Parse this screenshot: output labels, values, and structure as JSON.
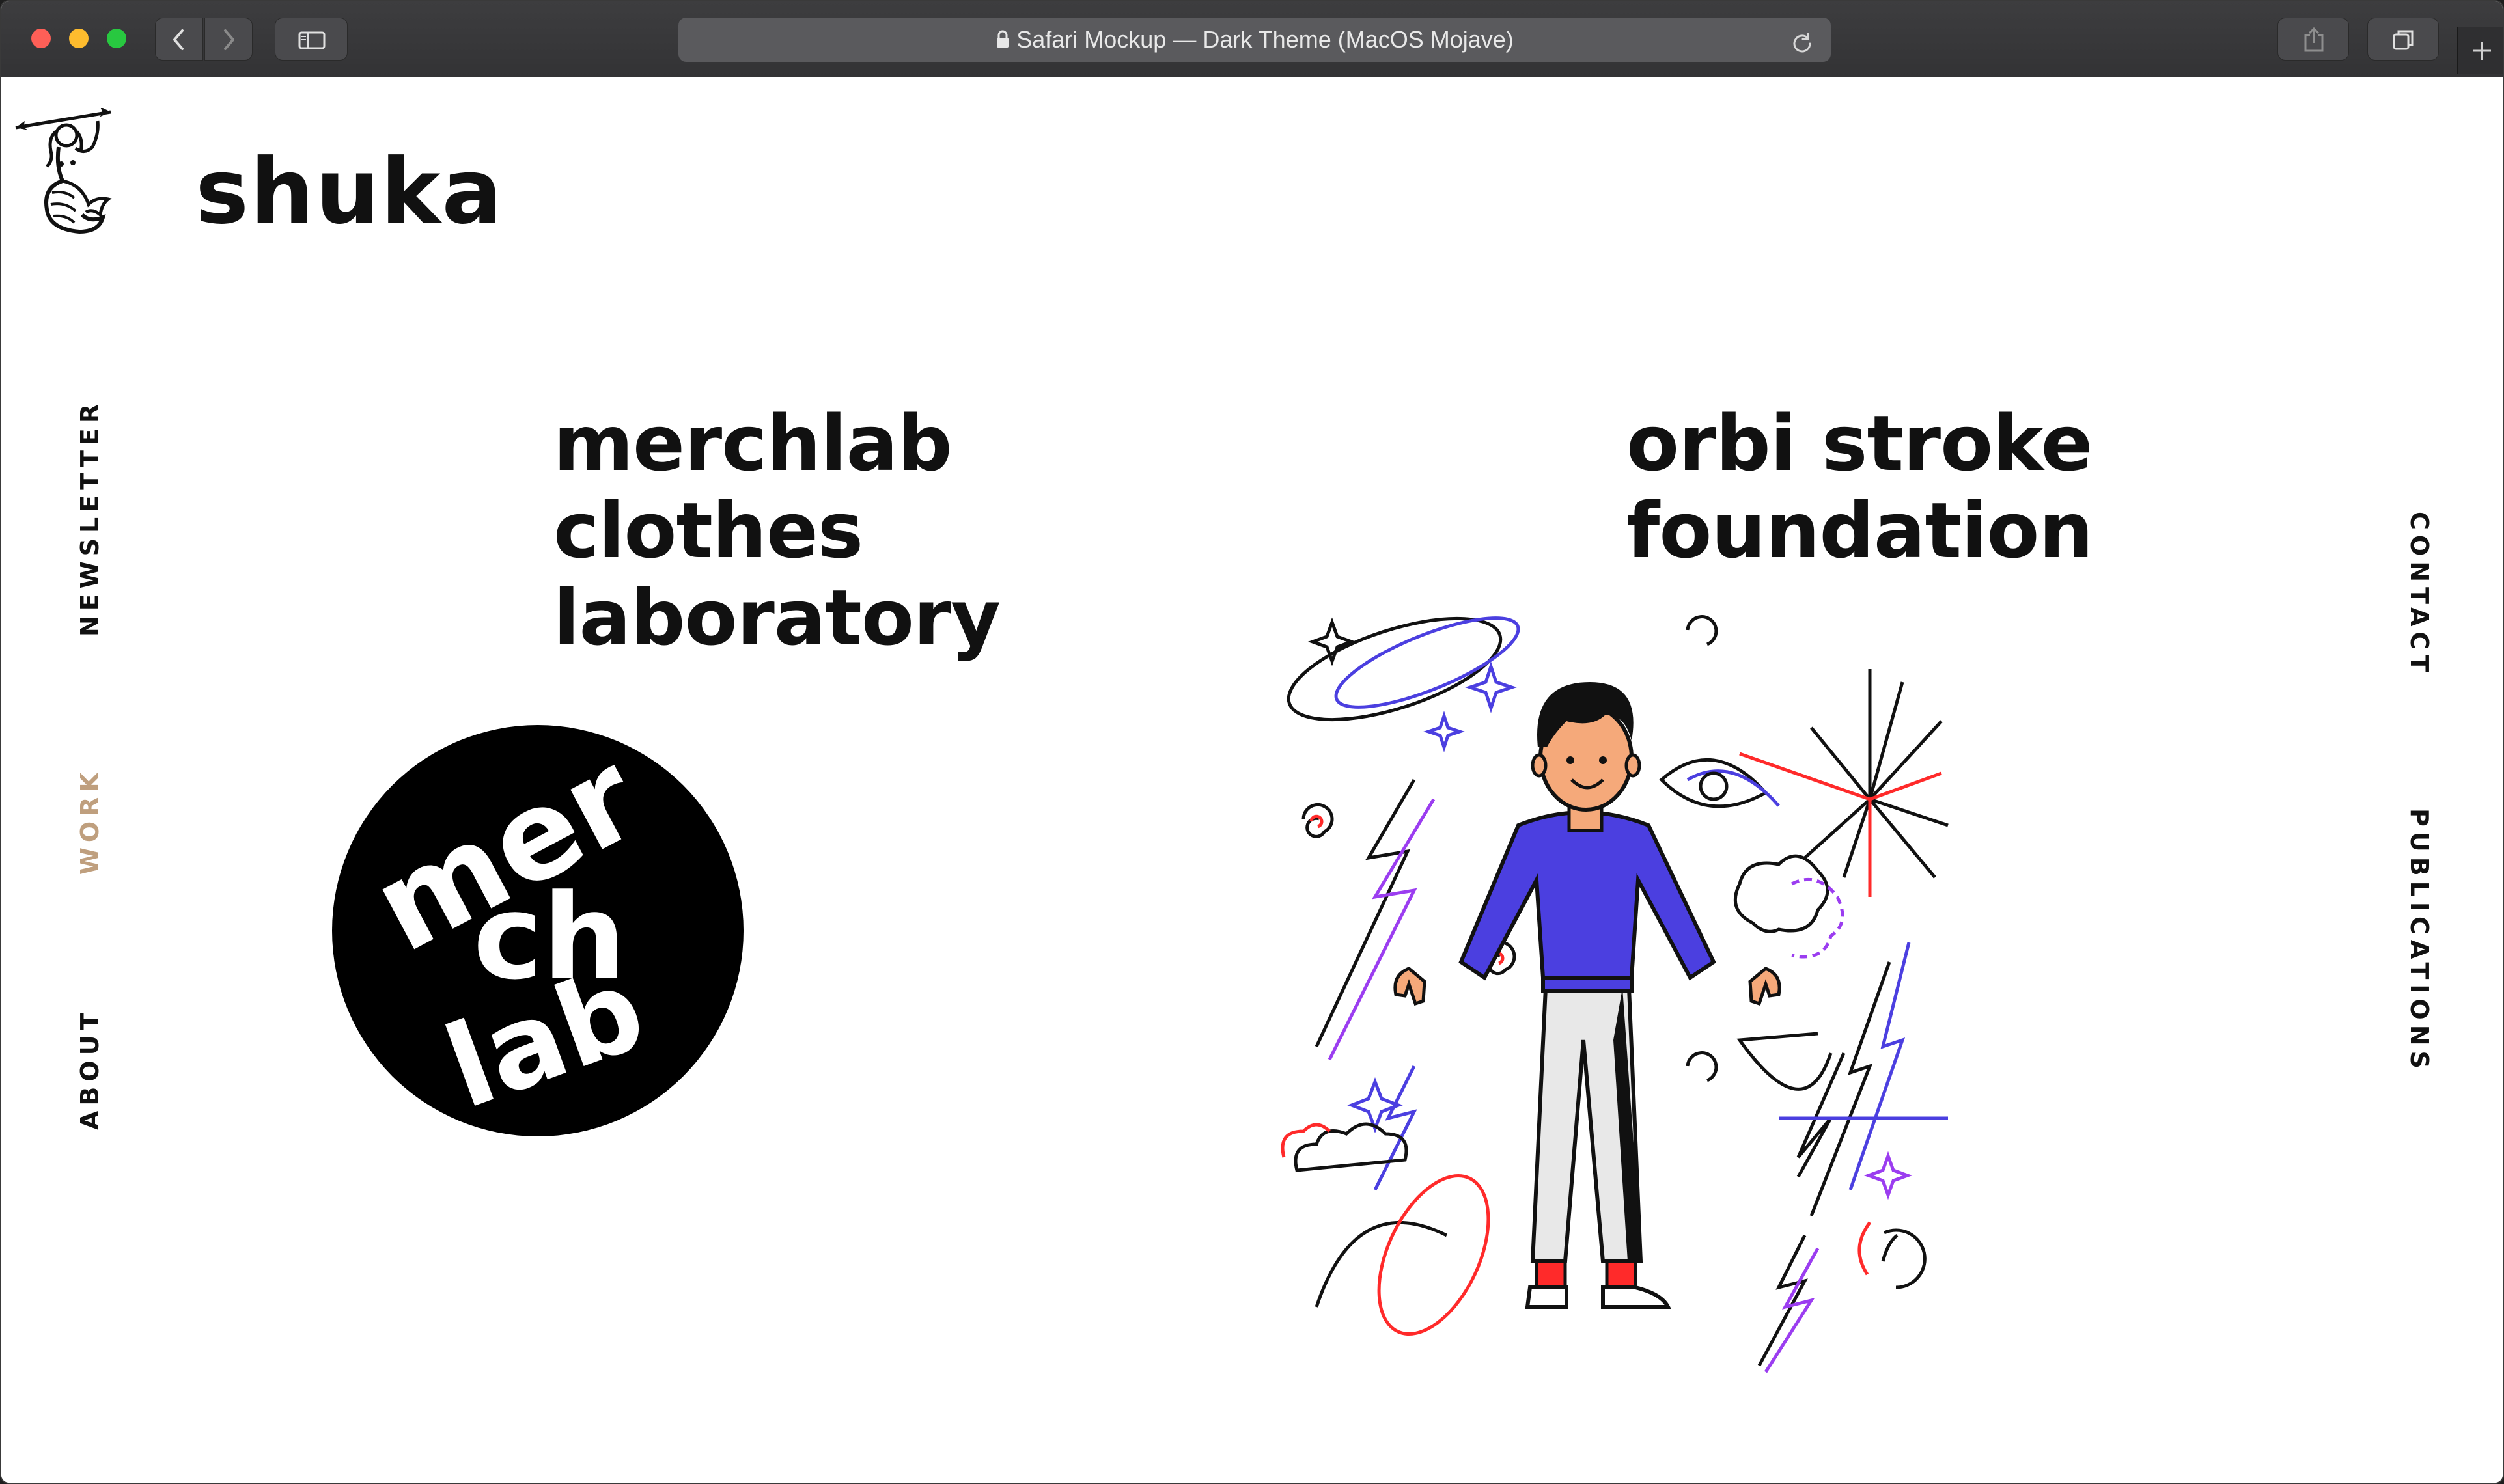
{
  "browser": {
    "address_text": "Safari Mockup — Dark Theme (MacOS Mojave)",
    "icons": [
      "back-icon",
      "forward-icon",
      "sidebar-icon",
      "lock-icon",
      "reload-icon",
      "share-icon",
      "tabs-icon",
      "new-tab-icon"
    ]
  },
  "site": {
    "brand": "shuka",
    "logo": "mermaid-logo",
    "nav_left": [
      "NEWSLETTER",
      "WORK",
      "ABOUT"
    ],
    "nav_right": [
      "CONTACT",
      "PUBLICATIONS"
    ],
    "active_nav": "WORK",
    "accent_color": "#bf9f7e"
  },
  "projects": [
    {
      "title_lines": [
        "merchlab",
        "clothes",
        "laboratory"
      ],
      "logo_text": [
        "mer",
        "ch",
        "lab"
      ]
    },
    {
      "title_lines": [
        "orbi stroke",
        "foundation"
      ],
      "illustration": "person-with-doodles"
    }
  ],
  "colors": {
    "toolbar": "#3d3d3f",
    "address_bar": "#5a5a5d",
    "shirt": "#4b3fe0",
    "skin": "#f5a97a",
    "doodle_red": "#ff2a2a",
    "doodle_purple": "#9b3df0",
    "doodle_blue": "#4b3fe0"
  }
}
